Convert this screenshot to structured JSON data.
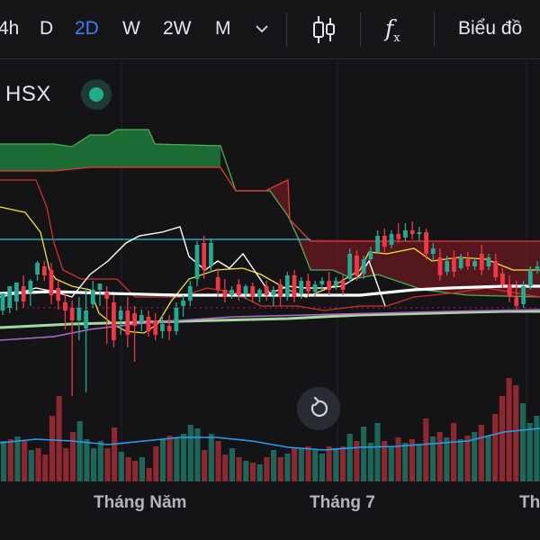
{
  "toolbar": {
    "timeframes": [
      "4h",
      "D",
      "2D",
      "W",
      "2W",
      "M"
    ],
    "active_timeframe": "2D",
    "chart_type_label": "Biểu đồ"
  },
  "symbol": {
    "exchange": "HSX",
    "status_color": "#1fae8a"
  },
  "colors": {
    "up": "#22ab94",
    "down": "#f23645",
    "cloud_bull": "#1f7a3a",
    "cloud_bear": "#8b1a26",
    "conversion": "#f5e03a",
    "base": "#d32f2f",
    "lagging": "#ffffff",
    "span_a": "#4caf50",
    "span_b": "#e53935",
    "ma_white": "#ffffff",
    "ma_green": "#a8d8a0",
    "ma_purple": "#b06ac8",
    "hline": "#26c6da",
    "volume_ma": "#2a9df4"
  },
  "chart_data": {
    "type": "candlestick",
    "x_axis_labels": [
      "Tháng Năm",
      "Tháng 7",
      "Th"
    ],
    "candles": [
      {
        "o": 345,
        "h": 330,
        "c": 326,
        "l": 350,
        "up": true
      },
      {
        "o": 342,
        "h": 325,
        "c": 318,
        "l": 348,
        "up": true
      },
      {
        "o": 335,
        "h": 320,
        "c": 314,
        "l": 345,
        "up": true
      },
      {
        "o": 318,
        "h": 306,
        "c": 335,
        "l": 342,
        "up": false
      },
      {
        "o": 325,
        "h": 310,
        "c": 312,
        "l": 340,
        "up": true
      },
      {
        "o": 305,
        "h": 290,
        "c": 292,
        "l": 312,
        "up": true
      },
      {
        "o": 296,
        "h": 290,
        "c": 306,
        "l": 312,
        "up": false
      },
      {
        "o": 300,
        "h": 292,
        "c": 328,
        "l": 338,
        "up": false
      },
      {
        "o": 320,
        "h": 312,
        "c": 334,
        "l": 344,
        "up": false
      },
      {
        "o": 336,
        "h": 326,
        "c": 345,
        "l": 366,
        "up": false
      },
      {
        "o": 342,
        "h": 334,
        "c": 356,
        "l": 440,
        "up": false
      },
      {
        "o": 356,
        "h": 330,
        "c": 342,
        "l": 378,
        "up": true
      },
      {
        "o": 365,
        "h": 320,
        "c": 345,
        "l": 436,
        "up": true
      },
      {
        "o": 338,
        "h": 312,
        "c": 322,
        "l": 342,
        "up": true
      },
      {
        "o": 322,
        "h": 315,
        "c": 315,
        "l": 340,
        "up": true
      },
      {
        "o": 325,
        "h": 318,
        "c": 332,
        "l": 382,
        "up": false
      },
      {
        "o": 336,
        "h": 328,
        "c": 378,
        "l": 386,
        "up": false
      },
      {
        "o": 355,
        "h": 340,
        "c": 345,
        "l": 372,
        "up": true
      },
      {
        "o": 345,
        "h": 330,
        "c": 372,
        "l": 386,
        "up": false
      },
      {
        "o": 348,
        "h": 340,
        "c": 362,
        "l": 402,
        "up": false
      },
      {
        "o": 358,
        "h": 344,
        "c": 350,
        "l": 368,
        "up": true
      },
      {
        "o": 352,
        "h": 345,
        "c": 368,
        "l": 374,
        "up": false
      },
      {
        "o": 356,
        "h": 348,
        "c": 372,
        "l": 378,
        "up": false
      },
      {
        "o": 368,
        "h": 350,
        "c": 360,
        "l": 376,
        "up": true
      },
      {
        "o": 362,
        "h": 350,
        "c": 368,
        "l": 378,
        "up": false
      },
      {
        "o": 368,
        "h": 336,
        "c": 342,
        "l": 372,
        "up": true
      },
      {
        "o": 340,
        "h": 328,
        "c": 334,
        "l": 352,
        "up": true
      },
      {
        "o": 334,
        "h": 312,
        "c": 318,
        "l": 340,
        "up": true
      },
      {
        "o": 310,
        "h": 268,
        "c": 272,
        "l": 318,
        "up": true
      },
      {
        "o": 270,
        "h": 262,
        "c": 300,
        "l": 310,
        "up": false
      },
      {
        "o": 296,
        "h": 265,
        "c": 270,
        "l": 302,
        "up": true
      },
      {
        "o": 308,
        "h": 298,
        "c": 322,
        "l": 330,
        "up": false
      },
      {
        "o": 322,
        "h": 310,
        "c": 330,
        "l": 336,
        "up": false
      },
      {
        "o": 328,
        "h": 318,
        "c": 322,
        "l": 332,
        "up": true
      },
      {
        "o": 316,
        "h": 310,
        "c": 328,
        "l": 334,
        "up": false
      },
      {
        "o": 326,
        "h": 316,
        "c": 318,
        "l": 332,
        "up": true
      },
      {
        "o": 318,
        "h": 314,
        "c": 330,
        "l": 336,
        "up": false
      },
      {
        "o": 330,
        "h": 320,
        "c": 322,
        "l": 336,
        "up": true
      },
      {
        "o": 318,
        "h": 312,
        "c": 328,
        "l": 334,
        "up": false
      },
      {
        "o": 328,
        "h": 318,
        "c": 322,
        "l": 340,
        "up": true
      },
      {
        "o": 316,
        "h": 310,
        "c": 330,
        "l": 340,
        "up": false
      },
      {
        "o": 330,
        "h": 302,
        "c": 306,
        "l": 334,
        "up": true
      },
      {
        "o": 306,
        "h": 300,
        "c": 330,
        "l": 336,
        "up": false
      },
      {
        "o": 326,
        "h": 308,
        "c": 312,
        "l": 332,
        "up": true
      },
      {
        "o": 312,
        "h": 304,
        "c": 324,
        "l": 330,
        "up": false
      },
      {
        "o": 324,
        "h": 312,
        "c": 316,
        "l": 330,
        "up": true
      },
      {
        "o": 316,
        "h": 308,
        "c": 312,
        "l": 322,
        "up": true
      },
      {
        "o": 312,
        "h": 302,
        "c": 322,
        "l": 328,
        "up": false
      },
      {
        "o": 318,
        "h": 308,
        "c": 312,
        "l": 322,
        "up": true
      },
      {
        "o": 312,
        "h": 306,
        "c": 322,
        "l": 328,
        "up": false
      },
      {
        "o": 310,
        "h": 276,
        "c": 282,
        "l": 314,
        "up": true
      },
      {
        "o": 284,
        "h": 278,
        "c": 306,
        "l": 312,
        "up": false
      },
      {
        "o": 304,
        "h": 284,
        "c": 288,
        "l": 310,
        "up": true
      },
      {
        "o": 288,
        "h": 274,
        "c": 280,
        "l": 290,
        "up": true
      },
      {
        "o": 280,
        "h": 256,
        "c": 262,
        "l": 282,
        "up": true
      },
      {
        "o": 262,
        "h": 254,
        "c": 274,
        "l": 280,
        "up": false
      },
      {
        "o": 272,
        "h": 256,
        "c": 260,
        "l": 276,
        "up": true
      },
      {
        "o": 260,
        "h": 248,
        "c": 266,
        "l": 270,
        "up": false
      },
      {
        "o": 264,
        "h": 248,
        "c": 256,
        "l": 268,
        "up": true
      },
      {
        "o": 256,
        "h": 246,
        "c": 260,
        "l": 266,
        "up": false
      },
      {
        "o": 260,
        "h": 252,
        "c": 258,
        "l": 268,
        "up": true
      },
      {
        "o": 258,
        "h": 254,
        "c": 282,
        "l": 288,
        "up": false
      },
      {
        "o": 282,
        "h": 270,
        "c": 276,
        "l": 290,
        "up": true
      },
      {
        "o": 286,
        "h": 276,
        "c": 306,
        "l": 312,
        "up": false
      },
      {
        "o": 302,
        "h": 284,
        "c": 290,
        "l": 306,
        "up": true
      },
      {
        "o": 286,
        "h": 278,
        "c": 302,
        "l": 308,
        "up": false
      },
      {
        "o": 298,
        "h": 282,
        "c": 286,
        "l": 300,
        "up": true
      },
      {
        "o": 288,
        "h": 280,
        "c": 296,
        "l": 300,
        "up": false
      },
      {
        "o": 296,
        "h": 286,
        "c": 290,
        "l": 300,
        "up": true
      },
      {
        "o": 282,
        "h": 272,
        "c": 300,
        "l": 306,
        "up": false
      },
      {
        "o": 296,
        "h": 282,
        "c": 286,
        "l": 300,
        "up": true
      },
      {
        "o": 290,
        "h": 282,
        "c": 308,
        "l": 312,
        "up": false
      },
      {
        "o": 304,
        "h": 298,
        "c": 316,
        "l": 320,
        "up": false
      },
      {
        "o": 316,
        "h": 306,
        "c": 330,
        "l": 336,
        "up": false
      },
      {
        "o": 330,
        "h": 312,
        "c": 340,
        "l": 344,
        "up": false
      },
      {
        "o": 338,
        "h": 312,
        "c": 318,
        "l": 342,
        "up": true
      },
      {
        "o": 318,
        "h": 296,
        "c": 300,
        "l": 322,
        "up": true
      },
      {
        "o": 300,
        "h": 290,
        "c": 296,
        "l": 304,
        "up": true
      }
    ],
    "volume": [
      {
        "v": 490,
        "up": true
      },
      {
        "v": 488,
        "up": false
      },
      {
        "v": 485,
        "up": true
      },
      {
        "v": 490,
        "up": false
      },
      {
        "v": 500,
        "up": true
      },
      {
        "v": 498,
        "up": false
      },
      {
        "v": 505,
        "up": false
      },
      {
        "v": 462,
        "up": false
      },
      {
        "v": 440,
        "up": false
      },
      {
        "v": 498,
        "up": false
      },
      {
        "v": 480,
        "up": false
      },
      {
        "v": 468,
        "up": true
      },
      {
        "v": 488,
        "up": true
      },
      {
        "v": 498,
        "up": true
      },
      {
        "v": 490,
        "up": true
      },
      {
        "v": 498,
        "up": false
      },
      {
        "v": 475,
        "up": false
      },
      {
        "v": 502,
        "up": true
      },
      {
        "v": 508,
        "up": false
      },
      {
        "v": 512,
        "up": false
      },
      {
        "v": 508,
        "up": true
      },
      {
        "v": 520,
        "up": false
      },
      {
        "v": 496,
        "up": false
      },
      {
        "v": 488,
        "up": true
      },
      {
        "v": 484,
        "up": false
      },
      {
        "v": 486,
        "up": true
      },
      {
        "v": 482,
        "up": true
      },
      {
        "v": 472,
        "up": true
      },
      {
        "v": 476,
        "up": true
      },
      {
        "v": 500,
        "up": false
      },
      {
        "v": 482,
        "up": true
      },
      {
        "v": 490,
        "up": false
      },
      {
        "v": 505,
        "up": false
      },
      {
        "v": 498,
        "up": true
      },
      {
        "v": 508,
        "up": false
      },
      {
        "v": 512,
        "up": true
      },
      {
        "v": 514,
        "up": false
      },
      {
        "v": 516,
        "up": true
      },
      {
        "v": 508,
        "up": false
      },
      {
        "v": 500,
        "up": true
      },
      {
        "v": 508,
        "up": false
      },
      {
        "v": 504,
        "up": true
      },
      {
        "v": 498,
        "up": false
      },
      {
        "v": 498,
        "up": true
      },
      {
        "v": 496,
        "up": false
      },
      {
        "v": 500,
        "up": true
      },
      {
        "v": 504,
        "up": true
      },
      {
        "v": 496,
        "up": false
      },
      {
        "v": 498,
        "up": true
      },
      {
        "v": 496,
        "up": false
      },
      {
        "v": 482,
        "up": true
      },
      {
        "v": 490,
        "up": false
      },
      {
        "v": 474,
        "up": true
      },
      {
        "v": 492,
        "up": true
      },
      {
        "v": 470,
        "up": true
      },
      {
        "v": 490,
        "up": false
      },
      {
        "v": 496,
        "up": true
      },
      {
        "v": 486,
        "up": false
      },
      {
        "v": 492,
        "up": true
      },
      {
        "v": 488,
        "up": false
      },
      {
        "v": 494,
        "up": true
      },
      {
        "v": 465,
        "up": false
      },
      {
        "v": 485,
        "up": true
      },
      {
        "v": 480,
        "up": false
      },
      {
        "v": 486,
        "up": true
      },
      {
        "v": 470,
        "up": false
      },
      {
        "v": 488,
        "up": true
      },
      {
        "v": 484,
        "up": false
      },
      {
        "v": 480,
        "up": true
      },
      {
        "v": 472,
        "up": false
      },
      {
        "v": 484,
        "up": true
      },
      {
        "v": 460,
        "up": false
      },
      {
        "v": 440,
        "up": false
      },
      {
        "v": 420,
        "up": false
      },
      {
        "v": 428,
        "up": false
      },
      {
        "v": 448,
        "up": true
      },
      {
        "v": 470,
        "up": true
      },
      {
        "v": 462,
        "up": true
      }
    ]
  }
}
